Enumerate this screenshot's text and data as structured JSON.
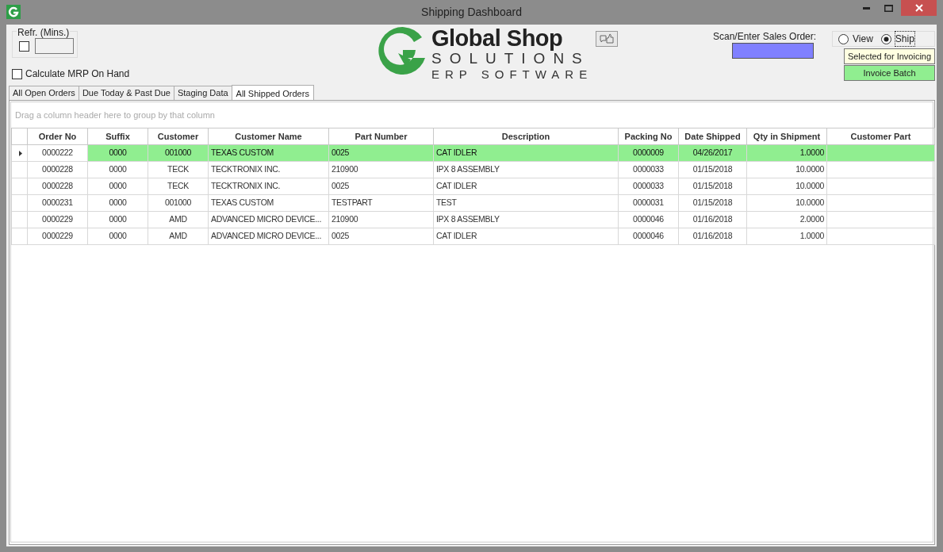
{
  "window": {
    "title": "Shipping Dashboard"
  },
  "refresh": {
    "label": "Refr. (Mins.)",
    "checked": false
  },
  "calculate_mrp": {
    "label": "Calculate MRP On Hand",
    "checked": false
  },
  "logo": {
    "line_1": "Global Shop",
    "line_2": "SOLUTIONS",
    "line_3": "ERP SOFTWARE"
  },
  "sales_order": {
    "label": "Scan/Enter Sales Order:"
  },
  "mode": [
    {
      "label": "View",
      "selected": false
    },
    {
      "label": "Ship",
      "selected": true
    }
  ],
  "selected_for_invoicing": "Selected for Invoicing",
  "invoice_batch": "Invoice Batch",
  "tabs": [
    {
      "label": "All Open Orders",
      "selected": false
    },
    {
      "label": "Due Today & Past Due",
      "selected": false
    },
    {
      "label": "Staging Data",
      "selected": false
    },
    {
      "label": "All Shipped Orders",
      "selected": true
    }
  ],
  "group_panel_hint": "Drag a column header here to group by that column",
  "table": {
    "columns": [
      "Order No",
      "Suffix",
      "Customer",
      "Customer Name",
      "Part Number",
      "Description",
      "Packing No",
      "Date Shipped",
      "Qty in Shipment",
      "Customer Part"
    ],
    "rows": [
      {
        "selected": true,
        "cells": [
          "0000222",
          "0000",
          "001000",
          "TEXAS CUSTOM",
          "0025",
          "CAT IDLER",
          "0000009",
          "04/26/2017",
          "1.0000",
          ""
        ]
      },
      {
        "selected": false,
        "cells": [
          "0000228",
          "0000",
          "TECK",
          "TECKTRONIX INC.",
          "210900",
          "IPX 8 ASSEMBLY",
          "0000033",
          "01/15/2018",
          "10.0000",
          ""
        ]
      },
      {
        "selected": false,
        "cells": [
          "0000228",
          "0000",
          "TECK",
          "TECKTRONIX INC.",
          "0025",
          "CAT IDLER",
          "0000033",
          "01/15/2018",
          "10.0000",
          ""
        ]
      },
      {
        "selected": false,
        "cells": [
          "0000231",
          "0000",
          "001000",
          "TEXAS CUSTOM",
          "TESTPART",
          "TEST",
          "0000031",
          "01/15/2018",
          "10.0000",
          ""
        ]
      },
      {
        "selected": false,
        "cells": [
          "0000229",
          "0000",
          "AMD",
          "ADVANCED MICRO DEVICE...",
          "210900",
          "IPX 8 ASSEMBLY",
          "0000046",
          "01/16/2018",
          "2.0000",
          ""
        ]
      },
      {
        "selected": false,
        "cells": [
          "0000229",
          "0000",
          "AMD",
          "ADVANCED MICRO DEVICE...",
          "0025",
          "CAT IDLER",
          "0000046",
          "01/16/2018",
          "1.0000",
          ""
        ]
      }
    ]
  }
}
